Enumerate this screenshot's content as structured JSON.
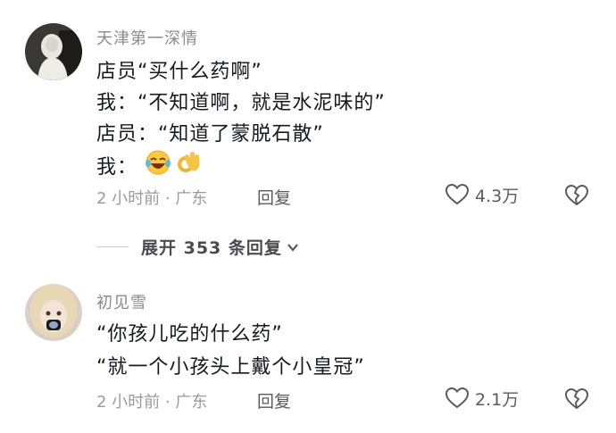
{
  "comments": [
    {
      "author": "天津第一深情",
      "lines": [
        "店员“买什么药啊”",
        "我：“不知道啊，就是水泥味的”",
        "店员：“知道了蒙脱石散”",
        "我："
      ],
      "emojis": [
        "laughing-crying-emoji",
        "ok-hand-emoji"
      ],
      "meta": "2 小时前 · 广东",
      "reply_label": "回复",
      "like_count": "4.3万"
    },
    {
      "author": "初见雪",
      "lines": [
        "“你孩儿吃的什么药”",
        "“就一个小孩头上戴个小皇冠”"
      ],
      "meta": "2 小时前 · 广东",
      "reply_label": "回复",
      "like_count": "2.1万"
    }
  ],
  "expand_replies_label": "展开 353 条回复",
  "icons": {
    "like": "heart-outline-icon",
    "dislike": "broken-heart-icon",
    "expand": "chevron-down-icon"
  },
  "colors": {
    "text_primary": "#161823",
    "text_secondary": "#8a8b91",
    "icon": "#5a5b61"
  }
}
